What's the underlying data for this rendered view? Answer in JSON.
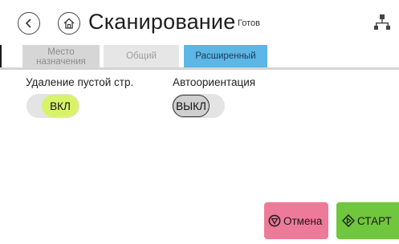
{
  "header": {
    "title": "Сканирование",
    "status": "Готов",
    "icons": [
      "back-icon",
      "home-icon",
      "network-icon"
    ]
  },
  "tabs": [
    {
      "label": "Место назначения",
      "active": false
    },
    {
      "label": "Общий",
      "active": false
    },
    {
      "label": "Расширенный",
      "active": true
    }
  ],
  "settings": {
    "blank_page_removal": {
      "label": "Удаление пустой стр.",
      "value": "ВКЛ",
      "on": true
    },
    "auto_orientation": {
      "label": "Автоориентация",
      "value": "ВЫКЛ",
      "on": false
    }
  },
  "actions": {
    "cancel_label": "Отмена",
    "start_label": "СТАРТ"
  },
  "colors": {
    "tab_active": "#5cb6e6",
    "toggle_on": "#d8f36a",
    "cancel": "#ee7a9a",
    "start": "#70c63c"
  }
}
